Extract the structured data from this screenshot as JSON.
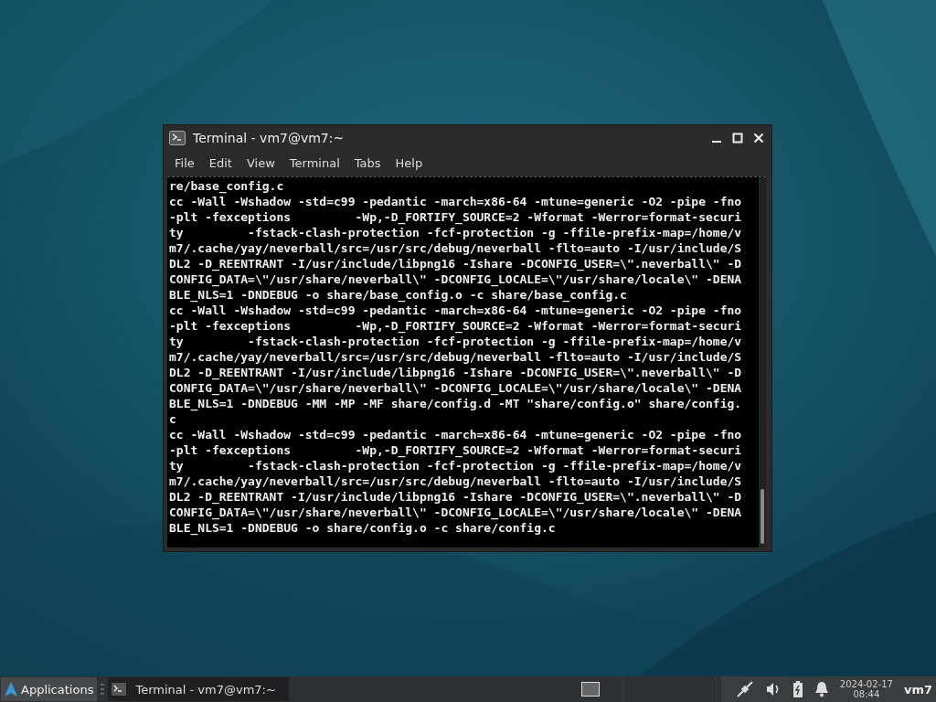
{
  "window": {
    "title": "Terminal - vm7@vm7:~"
  },
  "menu": [
    "File",
    "Edit",
    "View",
    "Terminal",
    "Tabs",
    "Help"
  ],
  "terminal_lines": [
    "re/base_config.c",
    "cc -Wall -Wshadow -std=c99 -pedantic -march=x86-64 -mtune=generic -O2 -pipe -fno",
    "-plt -fexceptions         -Wp,-D_FORTIFY_SOURCE=2 -Wformat -Werror=format-securi",
    "ty         -fstack-clash-protection -fcf-protection -g -ffile-prefix-map=/home/v",
    "m7/.cache/yay/neverball/src=/usr/src/debug/neverball -flto=auto -I/usr/include/S",
    "DL2 -D_REENTRANT -I/usr/include/libpng16 -Ishare -DCONFIG_USER=\\\".neverball\\\" -D",
    "CONFIG_DATA=\\\"/usr/share/neverball\\\" -DCONFIG_LOCALE=\\\"/usr/share/locale\\\" -DENA",
    "BLE_NLS=1 -DNDEBUG -o share/base_config.o -c share/base_config.c",
    "cc -Wall -Wshadow -std=c99 -pedantic -march=x86-64 -mtune=generic -O2 -pipe -fno",
    "-plt -fexceptions         -Wp,-D_FORTIFY_SOURCE=2 -Wformat -Werror=format-securi",
    "ty         -fstack-clash-protection -fcf-protection -g -ffile-prefix-map=/home/v",
    "m7/.cache/yay/neverball/src=/usr/src/debug/neverball -flto=auto -I/usr/include/S",
    "DL2 -D_REENTRANT -I/usr/include/libpng16 -Ishare -DCONFIG_USER=\\\".neverball\\\" -D",
    "CONFIG_DATA=\\\"/usr/share/neverball\\\" -DCONFIG_LOCALE=\\\"/usr/share/locale\\\" -DENA",
    "BLE_NLS=1 -DNDEBUG -MM -MP -MF share/config.d -MT \"share/config.o\" share/config.",
    "c",
    "cc -Wall -Wshadow -std=c99 -pedantic -march=x86-64 -mtune=generic -O2 -pipe -fno",
    "-plt -fexceptions         -Wp,-D_FORTIFY_SOURCE=2 -Wformat -Werror=format-securi",
    "ty         -fstack-clash-protection -fcf-protection -g -ffile-prefix-map=/home/v",
    "m7/.cache/yay/neverball/src=/usr/src/debug/neverball -flto=auto -I/usr/include/S",
    "DL2 -D_REENTRANT -I/usr/include/libpng16 -Ishare -DCONFIG_USER=\\\".neverball\\\" -D",
    "CONFIG_DATA=\\\"/usr/share/neverball\\\" -DCONFIG_LOCALE=\\\"/usr/share/locale\\\" -DENA",
    "BLE_NLS=1 -DNDEBUG -o share/config.o -c share/config.c"
  ],
  "taskbar": {
    "applications_label": "Applications",
    "tasks": [
      {
        "label": "Terminal - vm7@vm7:~",
        "selected": true
      }
    ],
    "date": "2024-02-17",
    "time": "08:44",
    "user": "vm7"
  }
}
